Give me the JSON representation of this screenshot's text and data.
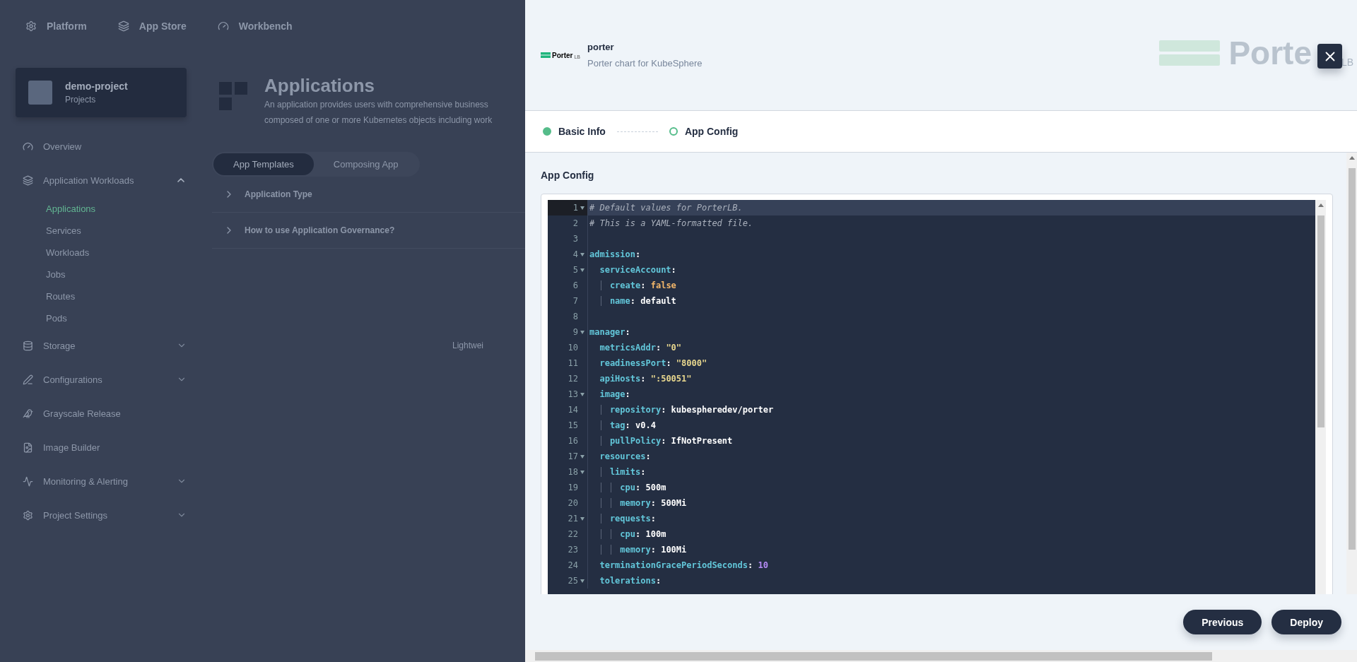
{
  "top_nav": [
    {
      "label": "Platform"
    },
    {
      "label": "App Store"
    },
    {
      "label": "Workbench"
    }
  ],
  "project": {
    "name": "demo-project",
    "type": "Projects"
  },
  "sidebar": {
    "items": [
      {
        "kind": "link",
        "label": "Overview"
      },
      {
        "kind": "group",
        "label": "Application Workloads",
        "expanded": true,
        "children": [
          {
            "label": "Applications",
            "selected": true
          },
          {
            "label": "Services",
            "selected": false
          },
          {
            "label": "Workloads",
            "selected": false
          },
          {
            "label": "Jobs",
            "selected": false
          },
          {
            "label": "Routes",
            "selected": false
          },
          {
            "label": "Pods",
            "selected": false
          }
        ]
      },
      {
        "kind": "group",
        "label": "Storage",
        "expanded": false
      },
      {
        "kind": "group",
        "label": "Configurations",
        "expanded": false
      },
      {
        "kind": "link",
        "label": "Grayscale Release"
      },
      {
        "kind": "link",
        "label": "Image Builder"
      },
      {
        "kind": "group",
        "label": "Monitoring & Alerting",
        "expanded": false
      },
      {
        "kind": "group",
        "label": "Project Settings",
        "expanded": false
      }
    ]
  },
  "main": {
    "title": "Applications",
    "description": [
      "An application provides users with comprehensive business",
      "composed of one or more Kubernetes objects including work"
    ],
    "tabs": [
      {
        "label": "App Templates",
        "selected": true
      },
      {
        "label": "Composing App",
        "selected": false
      }
    ],
    "accordion": [
      {
        "label": "Application Type"
      },
      {
        "label": "How to use Application Governance?"
      }
    ],
    "cut_text": "Lightwei"
  },
  "drawer": {
    "logo_text": "Porter",
    "logo_suffix": "LB",
    "app_name": "porter",
    "app_description": "Porter chart for KubeSphere",
    "banner_text": "Porte",
    "banner_suffix": "LB",
    "steps": [
      {
        "label": "Basic Info",
        "done": true
      },
      {
        "label": "App Config",
        "done": false
      }
    ],
    "section_title": "App Config",
    "code": [
      {
        "n": "1",
        "fold": true,
        "active": true,
        "tokens": [
          {
            "kind": "comment",
            "text": "# Default values for PorterLB."
          }
        ]
      },
      {
        "n": "2",
        "fold": false,
        "active": false,
        "tokens": [
          {
            "kind": "comment",
            "text": "# This is a YAML-formatted file."
          }
        ]
      },
      {
        "n": "3",
        "fold": false,
        "active": false
      },
      {
        "n": "4",
        "fold": true,
        "active": false,
        "tokens": [
          {
            "kind": "key",
            "text": "admission"
          },
          {
            "kind": "punct",
            "text": ":"
          }
        ]
      },
      {
        "n": "5",
        "fold": true,
        "active": false,
        "tokens": [
          {
            "kind": "key",
            "text": "  serviceAccount"
          },
          {
            "kind": "punct",
            "text": ":"
          }
        ]
      },
      {
        "n": "6",
        "fold": false,
        "active": false,
        "tokens": [
          {
            "kind": "key",
            "text": "    create"
          },
          {
            "kind": "punct",
            "text": ": "
          },
          {
            "kind": "bool",
            "text": "false"
          }
        ]
      },
      {
        "n": "7",
        "fold": false,
        "active": false,
        "tokens": [
          {
            "kind": "key",
            "text": "    name"
          },
          {
            "kind": "punct",
            "text": ": "
          },
          {
            "kind": "plain",
            "text": "default"
          }
        ]
      },
      {
        "n": "8",
        "fold": false,
        "active": false
      },
      {
        "n": "9",
        "fold": true,
        "active": false,
        "tokens": [
          {
            "kind": "key",
            "text": "manager"
          },
          {
            "kind": "punct",
            "text": ":"
          }
        ]
      },
      {
        "n": "10",
        "fold": false,
        "active": false,
        "tokens": [
          {
            "kind": "key",
            "text": "  metricsAddr"
          },
          {
            "kind": "punct",
            "text": ": "
          },
          {
            "kind": "string",
            "text": "\"0\""
          }
        ]
      },
      {
        "n": "11",
        "fold": false,
        "active": false,
        "tokens": [
          {
            "kind": "key",
            "text": "  readinessPort"
          },
          {
            "kind": "punct",
            "text": ": "
          },
          {
            "kind": "string",
            "text": "\"8000\""
          }
        ]
      },
      {
        "n": "12",
        "fold": false,
        "active": false,
        "tokens": [
          {
            "kind": "key",
            "text": "  apiHosts"
          },
          {
            "kind": "punct",
            "text": ": "
          },
          {
            "kind": "string",
            "text": "\":50051\""
          }
        ]
      },
      {
        "n": "13",
        "fold": true,
        "active": false,
        "tokens": [
          {
            "kind": "key",
            "text": "  image"
          },
          {
            "kind": "punct",
            "text": ":"
          }
        ]
      },
      {
        "n": "14",
        "fold": false,
        "active": false,
        "tokens": [
          {
            "kind": "key",
            "text": "    repository"
          },
          {
            "kind": "punct",
            "text": ": "
          },
          {
            "kind": "plain",
            "text": "kubespheredev/porter"
          }
        ]
      },
      {
        "n": "15",
        "fold": false,
        "active": false,
        "tokens": [
          {
            "kind": "key",
            "text": "    tag"
          },
          {
            "kind": "punct",
            "text": ": "
          },
          {
            "kind": "plain",
            "text": "v0.4"
          }
        ]
      },
      {
        "n": "16",
        "fold": false,
        "active": false,
        "tokens": [
          {
            "kind": "key",
            "text": "    pullPolicy"
          },
          {
            "kind": "punct",
            "text": ": "
          },
          {
            "kind": "plain",
            "text": "IfNotPresent"
          }
        ]
      },
      {
        "n": "17",
        "fold": true,
        "active": false,
        "tokens": [
          {
            "kind": "key",
            "text": "  resources"
          },
          {
            "kind": "punct",
            "text": ":"
          }
        ]
      },
      {
        "n": "18",
        "fold": true,
        "active": false,
        "tokens": [
          {
            "kind": "key",
            "text": "    limits"
          },
          {
            "kind": "punct",
            "text": ":"
          }
        ]
      },
      {
        "n": "19",
        "fold": false,
        "active": false,
        "tokens": [
          {
            "kind": "key",
            "text": "      cpu"
          },
          {
            "kind": "punct",
            "text": ": "
          },
          {
            "kind": "plain",
            "text": "500m"
          }
        ]
      },
      {
        "n": "20",
        "fold": false,
        "active": false,
        "tokens": [
          {
            "kind": "key",
            "text": "      memory"
          },
          {
            "kind": "punct",
            "text": ": "
          },
          {
            "kind": "plain",
            "text": "500Mi"
          }
        ]
      },
      {
        "n": "21",
        "fold": true,
        "active": false,
        "tokens": [
          {
            "kind": "key",
            "text": "    requests"
          },
          {
            "kind": "punct",
            "text": ":"
          }
        ]
      },
      {
        "n": "22",
        "fold": false,
        "active": false,
        "tokens": [
          {
            "kind": "key",
            "text": "      cpu"
          },
          {
            "kind": "punct",
            "text": ": "
          },
          {
            "kind": "plain",
            "text": "100m"
          }
        ]
      },
      {
        "n": "23",
        "fold": false,
        "active": false,
        "tokens": [
          {
            "kind": "key",
            "text": "      memory"
          },
          {
            "kind": "punct",
            "text": ": "
          },
          {
            "kind": "plain",
            "text": "100Mi"
          }
        ]
      },
      {
        "n": "24",
        "fold": false,
        "active": false,
        "tokens": [
          {
            "kind": "key",
            "text": "  terminationGracePeriodSeconds"
          },
          {
            "kind": "punct",
            "text": ": "
          },
          {
            "kind": "number",
            "text": "10"
          }
        ]
      },
      {
        "n": "25",
        "fold": true,
        "active": false,
        "tokens": [
          {
            "kind": "key",
            "text": "  tolerations"
          },
          {
            "kind": "punct",
            "text": ":"
          }
        ]
      }
    ],
    "buttons": [
      {
        "label": "Previous"
      },
      {
        "label": "Deploy"
      }
    ]
  }
}
